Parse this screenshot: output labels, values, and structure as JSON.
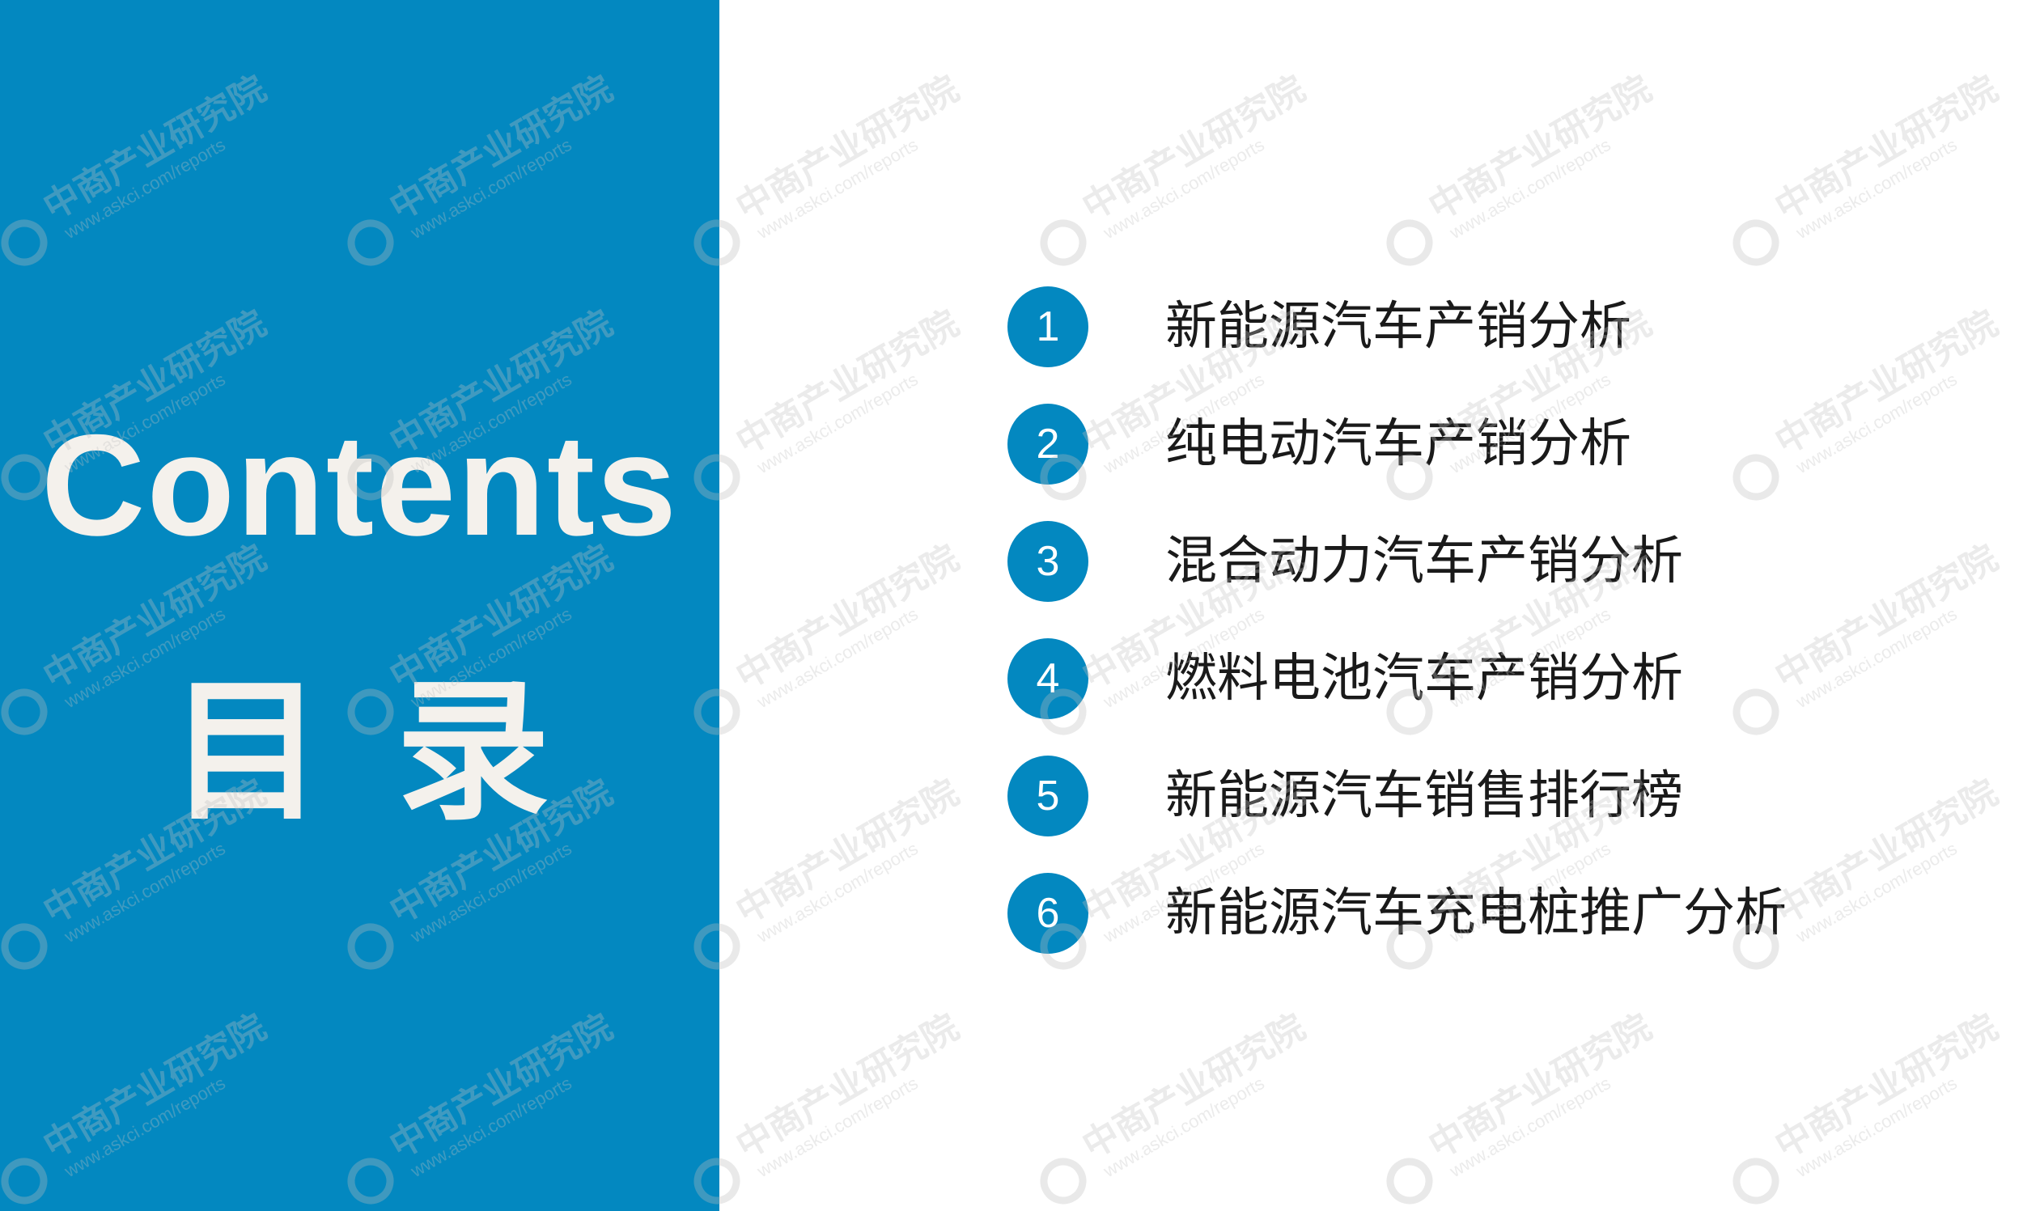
{
  "colors": {
    "panel": "#0388c0",
    "panel_text": "#f4f1ec",
    "number_circle": "#0388c0",
    "item_text": "#1a1a1a",
    "watermark": "#cfcfcf"
  },
  "left_panel": {
    "title_en": "Contents",
    "title_cn": "目录"
  },
  "toc": {
    "items": [
      {
        "number": "1",
        "label": "新能源汽车产销分析"
      },
      {
        "number": "2",
        "label": "纯电动汽车产销分析"
      },
      {
        "number": "3",
        "label": "混合动力汽车产销分析"
      },
      {
        "number": "4",
        "label": "燃料电池汽车产销分析"
      },
      {
        "number": "5",
        "label": "新能源汽车销售排行榜"
      },
      {
        "number": "6",
        "label": "新能源汽车充电桩推广分析"
      }
    ]
  },
  "watermark": {
    "brand": "中商产业研究院",
    "url": "www.askci.com/reports",
    "icon": "askci-logo-icon"
  }
}
